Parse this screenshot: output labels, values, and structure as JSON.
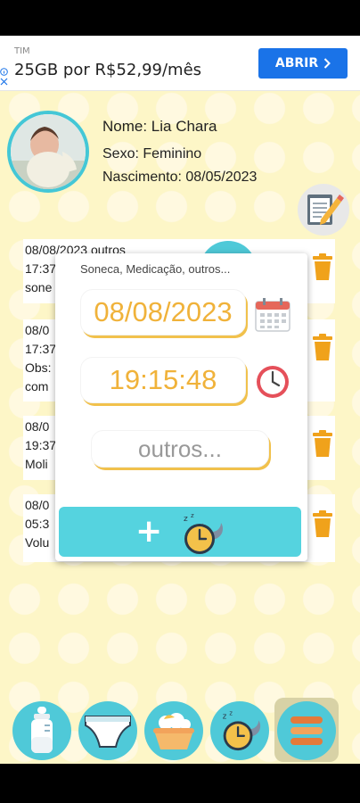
{
  "ad": {
    "sponsor": "TIM",
    "text": "25GB por R$52,99/mês",
    "button_label": "ABRIR",
    "info_icon": "info-icon",
    "close_icon": "close-icon",
    "button_color": "#1a73e8"
  },
  "profile": {
    "name_line": "Nome: Lia Chara",
    "sex_line": "Sexo: Feminino",
    "birth_line": "Nascimento: 08/05/2023",
    "edit_icon": "pencil-notepad-icon"
  },
  "log": {
    "entries": [
      {
        "line1": "08/08/2023 outros",
        "line2": "17:37",
        "line3": "sone"
      },
      {
        "line1": "08/0",
        "line2": "17:37",
        "line3": "Obs:",
        "line4": "com"
      },
      {
        "line1": "08/0",
        "line2": "19:37",
        "line3": "Moli"
      },
      {
        "line1": "08/0",
        "line2": "05:3",
        "line3": "Volu"
      }
    ],
    "trash_icon": "trash-icon"
  },
  "overlay": {
    "title": "Soneca, Medicação, outros...",
    "date": "08/08/2023",
    "time": "19:15:48",
    "category_placeholder": "outros...",
    "add_label": "+",
    "calendar_icon": "calendar-icon",
    "clock_icon": "clock-icon",
    "sleep_clock_icon": "sleep-clock-icon",
    "accent_color": "#f0b23a",
    "button_color": "#55d3df"
  },
  "nav": {
    "items": [
      {
        "name": "bottle-icon"
      },
      {
        "name": "diaper-icon"
      },
      {
        "name": "bath-icon"
      },
      {
        "name": "sleep-clock-icon"
      },
      {
        "name": "menu-icon"
      }
    ]
  },
  "colors": {
    "background": "#fdf6c7",
    "teal": "#4fc9d8",
    "orange": "#f0a21b"
  }
}
